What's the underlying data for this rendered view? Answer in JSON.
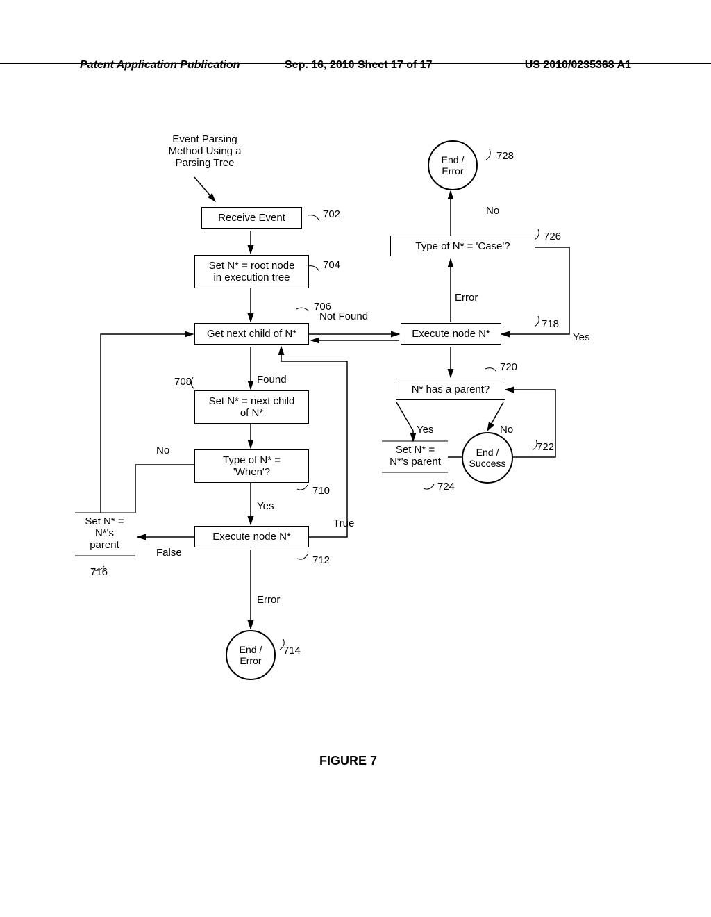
{
  "header": {
    "left": "Patent Application Publication",
    "center": "Sep. 16, 2010  Sheet 17 of 17",
    "right": "US 2010/0235368 A1"
  },
  "title": {
    "line1": "Event Parsing",
    "line2": "Method Using a",
    "line3": "Parsing Tree"
  },
  "boxes": {
    "b702": "Receive Event",
    "b704_l1": "Set N* = root node",
    "b704_l2": "in execution tree",
    "b706": "Get next child of N*",
    "b708_l1": "Set N* = next child",
    "b708_l2": "of N*",
    "b710_l1": "Type of N* =",
    "b710_l2": "'When'?",
    "b712": "Execute node N*",
    "b716_l1": "Set N* =",
    "b716_l2": "N*'s",
    "b716_l3": "parent",
    "b718": "Execute node N*",
    "b720": "N* has a parent?",
    "b724_l1": "Set N* =",
    "b724_l2": "N*'s parent",
    "b726": "Type of N* = 'Case'?"
  },
  "circles": {
    "c714_l1": "End /",
    "c714_l2": "Error",
    "c722_l1": "End /",
    "c722_l2": "Success",
    "c728_l1": "End /",
    "c728_l2": "Error"
  },
  "edges": {
    "notfound": "Not Found",
    "found": "Found",
    "yes": "Yes",
    "no": "No",
    "true": "True",
    "false": "False",
    "error": "Error"
  },
  "refs": {
    "r702": "702",
    "r704": "704",
    "r706": "706",
    "r708": "708",
    "r710": "710",
    "r712": "712",
    "r714": "714",
    "r716": "716",
    "r718": "718",
    "r720": "720",
    "r722": "722",
    "r724": "724",
    "r726": "726",
    "r728": "728"
  },
  "figure": "FIGURE 7"
}
